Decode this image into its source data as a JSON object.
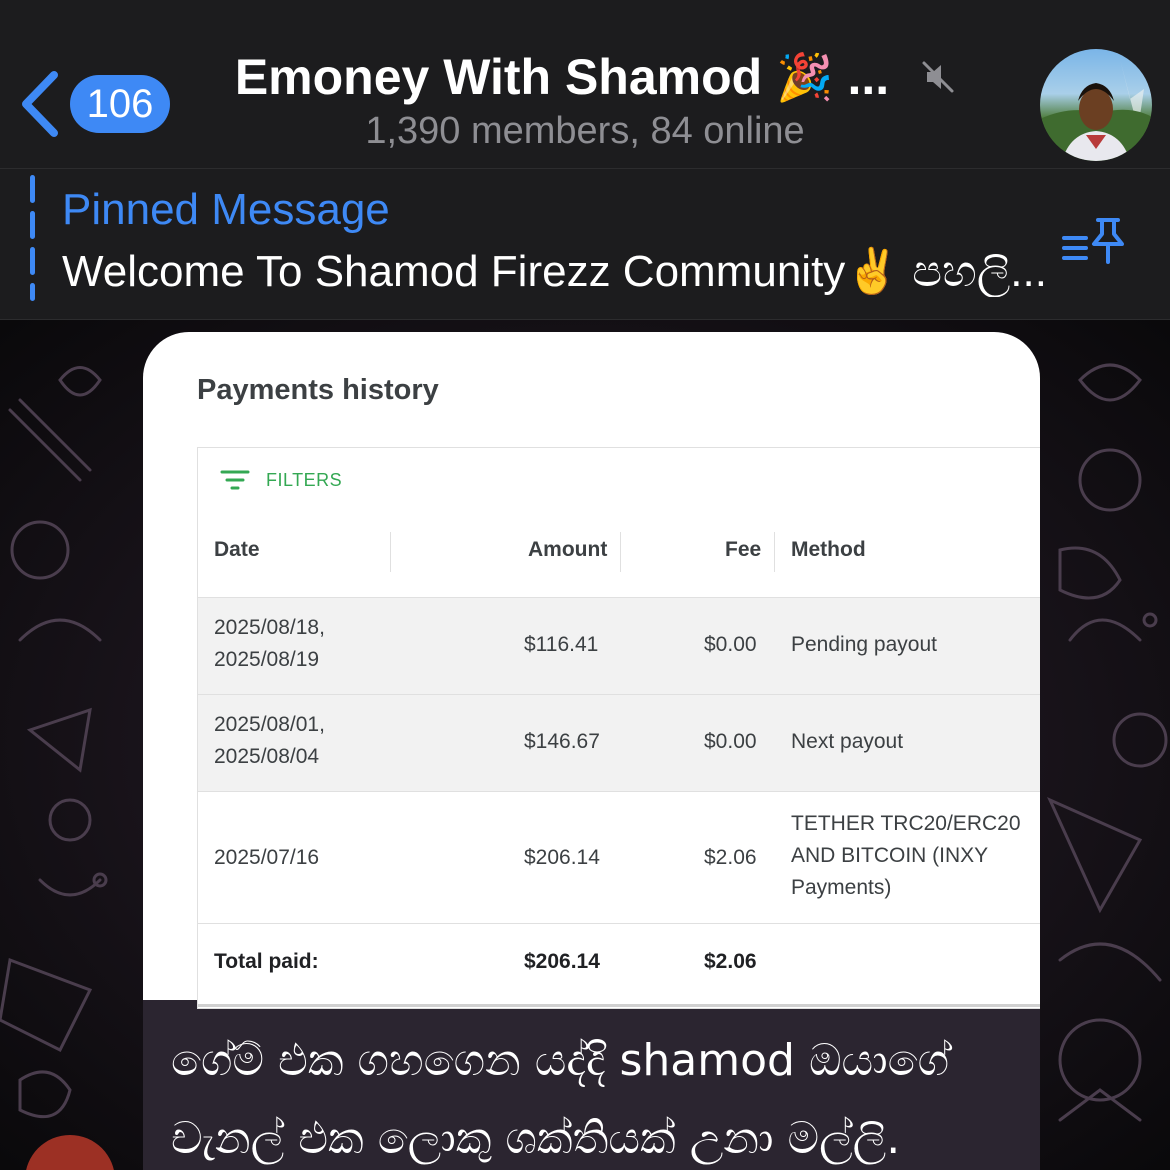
{
  "header": {
    "back_badge": "106",
    "title": "Emoney With Shamod",
    "title_emoji": "🎉",
    "title_ellipsis": "...",
    "subtitle": "1,390 members, 84 online",
    "accent_color": "#3e89f5",
    "icons": [
      "back-chevron-icon",
      "mute-icon",
      "avatar"
    ]
  },
  "pinned": {
    "label": "Pinned Message",
    "text": "Welcome To Shamod Firezz Community✌️ පහලි...",
    "icon": "pinned-list-icon"
  },
  "message": {
    "screenshot": {
      "title": "Payments history",
      "filters_label": "FILTERS",
      "columns": [
        "Date",
        "Amount",
        "Fee",
        "Method"
      ],
      "rows": [
        {
          "date_line1": "2025/08/18,",
          "date_line2": "2025/08/19",
          "amount": "$116.41",
          "fee": "$0.00",
          "method_line1": "Pending payout",
          "method_line2": "",
          "method_line3": ""
        },
        {
          "date_line1": "2025/08/01,",
          "date_line2": "2025/08/04",
          "amount": "$146.67",
          "fee": "$0.00",
          "method_line1": "Next payout",
          "method_line2": "",
          "method_line3": ""
        },
        {
          "date_line1": "2025/07/16",
          "date_line2": "",
          "amount": "$206.14",
          "fee": "$2.06",
          "method_line1": "TETHER TRC20/ERC20",
          "method_line2": "AND BITCOIN (INXY",
          "method_line3": "Payments)"
        }
      ],
      "total": {
        "label": "Total paid:",
        "amount": "$206.14",
        "fee": "$2.06"
      }
    },
    "caption_line1": "ගේම් එක ගහගෙන යද්දි shamod ඔයාගේ",
    "caption_line2": "චැනල් එක ලොකු ශක්තියක් උනා මල්ලි."
  }
}
